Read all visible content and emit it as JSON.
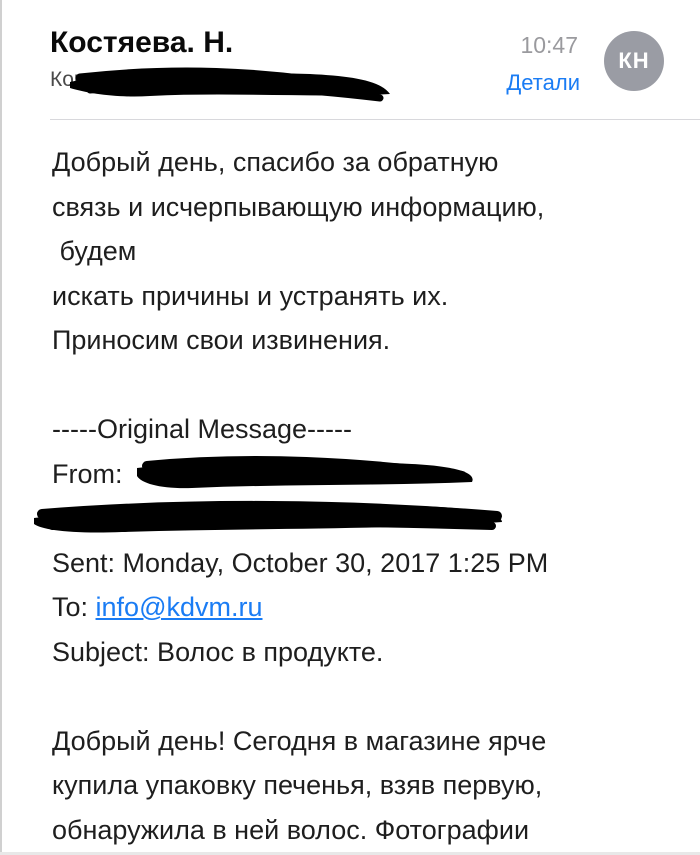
{
  "header": {
    "sender": "Костяева. Н.",
    "to_label": "Кому:",
    "time": "10:47",
    "details_label": "Детали",
    "avatar_initials": "КН"
  },
  "colors": {
    "link": "#1a7cf4",
    "avatar_bg": "#9a9ca4",
    "time": "#9a9a9e"
  },
  "body": {
    "reply": [
      "Добрый день, спасибо за обратную",
      "связь и исчерпывающую информацию,",
      " будем",
      "искать причины и устранять их.",
      "Приносим свои извинения."
    ],
    "original_header": "-----Original Message-----",
    "from_label": "From:",
    "sent": "Sent: Monday, October 30, 2017 1:25 PM",
    "to_label": "To:",
    "to_email": "info@kdvm.ru",
    "subject": "Subject: Волос в продукте.",
    "original": [
      "Добрый день! Сегодня в магазине ярче",
      "купила упаковку печенья, взяв первую,",
      "обнаружила в ней волос. Фотографии"
    ]
  }
}
